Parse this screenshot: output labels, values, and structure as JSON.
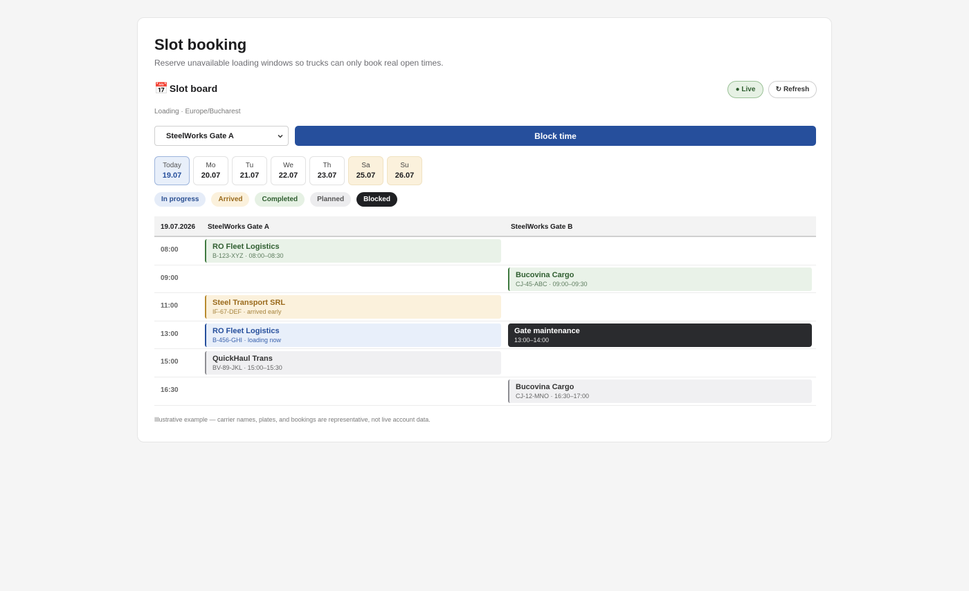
{
  "header": {
    "title": "Slot booking",
    "subtitle": "Reserve unavailable loading windows so trucks can only book real open times."
  },
  "board": {
    "icon": "calendar-icon",
    "icon_glyph": "📅",
    "title": "Slot board",
    "live_label": "● Live",
    "refresh_label": "↻ Refresh",
    "meta": "Loading · Europe/Bucharest"
  },
  "controls": {
    "gate_selected": "SteelWorks Gate A",
    "block_label": "Block time"
  },
  "days": [
    {
      "name": "Today",
      "date": "19.07"
    },
    {
      "name": "Mo",
      "date": "20.07"
    },
    {
      "name": "Tu",
      "date": "21.07"
    },
    {
      "name": "We",
      "date": "22.07"
    },
    {
      "name": "Th",
      "date": "23.07"
    },
    {
      "name": "Sa",
      "date": "25.07"
    },
    {
      "name": "Su",
      "date": "26.07"
    }
  ],
  "legend": {
    "in_progress": "In progress",
    "arrived": "Arrived",
    "completed": "Completed",
    "planned": "Planned",
    "blocked": "Blocked"
  },
  "schedule": {
    "date": "19.07.2026",
    "gate_a": "SteelWorks Gate A",
    "gate_b": "SteelWorks Gate B",
    "rows": [
      {
        "time": "08:00",
        "a": {
          "name": "RO Fleet Logistics",
          "detail": "B-123-XYZ · 08:00–08:30"
        }
      },
      {
        "time": "09:00",
        "b": {
          "name": "Bucovina Cargo",
          "detail": "CJ-45-ABC · 09:00–09:30"
        }
      },
      {
        "time": "11:00",
        "a": {
          "name": "Steel Transport SRL",
          "detail": "IF-67-DEF · arrived early"
        }
      },
      {
        "time": "13:00",
        "a": {
          "name": "RO Fleet Logistics",
          "detail": "B-456-GHI · loading now"
        },
        "b": {
          "name": "Gate maintenance",
          "detail": "13:00–14:00"
        }
      },
      {
        "time": "15:00",
        "a": {
          "name": "QuickHaul Trans",
          "detail": "BV-89-JKL · 15:00–15:30"
        }
      },
      {
        "time": "16:30",
        "b": {
          "name": "Bucovina Cargo",
          "detail": "CJ-12-MNO · 16:30–17:00"
        }
      }
    ]
  },
  "footnote": "Illustrative example — carrier names, plates, and bookings are representative, not live account data.",
  "colors": {
    "primary": "#264f9c",
    "completed": "#3f7a40",
    "arrived": "#b88a2e",
    "blocked": "#2a2b2e"
  }
}
